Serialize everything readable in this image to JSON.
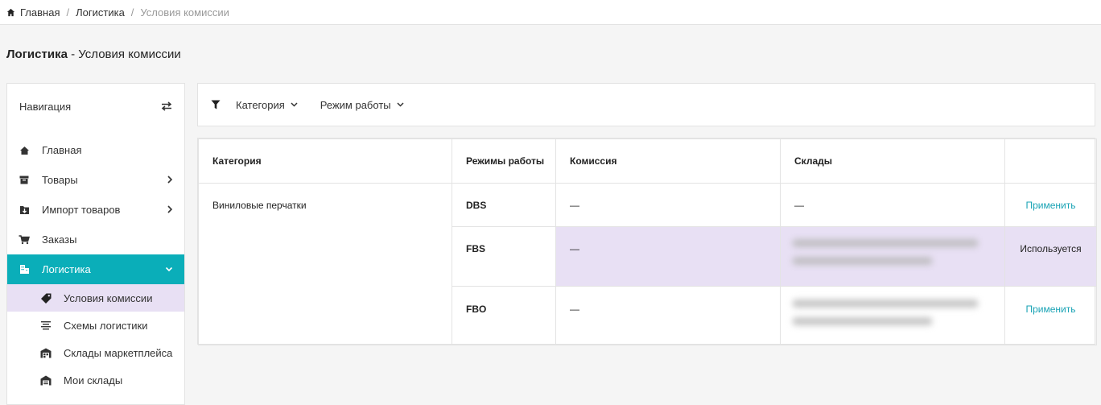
{
  "breadcrumb": {
    "items": [
      "Главная",
      "Логистика",
      "Условия комиссии"
    ],
    "separator": "/"
  },
  "page_title": {
    "section": "Логистика",
    "dash": " - ",
    "subtitle": "Условия комиссии"
  },
  "sidebar": {
    "title": "Навигация",
    "items": [
      {
        "label": "Главная",
        "icon": "home-icon"
      },
      {
        "label": "Товары",
        "icon": "box-icon"
      },
      {
        "label": "Импорт товаров",
        "icon": "import-icon"
      },
      {
        "label": "Заказы",
        "icon": "cart-icon"
      },
      {
        "label": "Логистика",
        "icon": "buildings-icon"
      }
    ],
    "sub_items": [
      {
        "label": "Условия комиссии",
        "icon": "tag-icon"
      },
      {
        "label": "Схемы логистики",
        "icon": "list-icon"
      },
      {
        "label": "Склады маркетплейса",
        "icon": "warehouse-icon"
      },
      {
        "label": "Мои склады",
        "icon": "store-icon"
      }
    ]
  },
  "filters": {
    "category": "Категория",
    "mode": "Режим работы"
  },
  "table": {
    "headers": [
      "Категория",
      "Режимы работы",
      "Комиссия",
      "Склады",
      ""
    ],
    "category": "Виниловые перчатки",
    "rows": [
      {
        "mode": "DBS",
        "commission": "—",
        "warehouses": "—",
        "action": "Применить"
      },
      {
        "mode": "FBS",
        "commission": "—",
        "warehouses": "",
        "action": "Используется"
      },
      {
        "mode": "FBO",
        "commission": "—",
        "warehouses": "",
        "action": "Применить"
      }
    ]
  },
  "colors": {
    "accent": "#0aaeb9",
    "highlight": "#e8e0f4",
    "link": "#19a3b5"
  }
}
